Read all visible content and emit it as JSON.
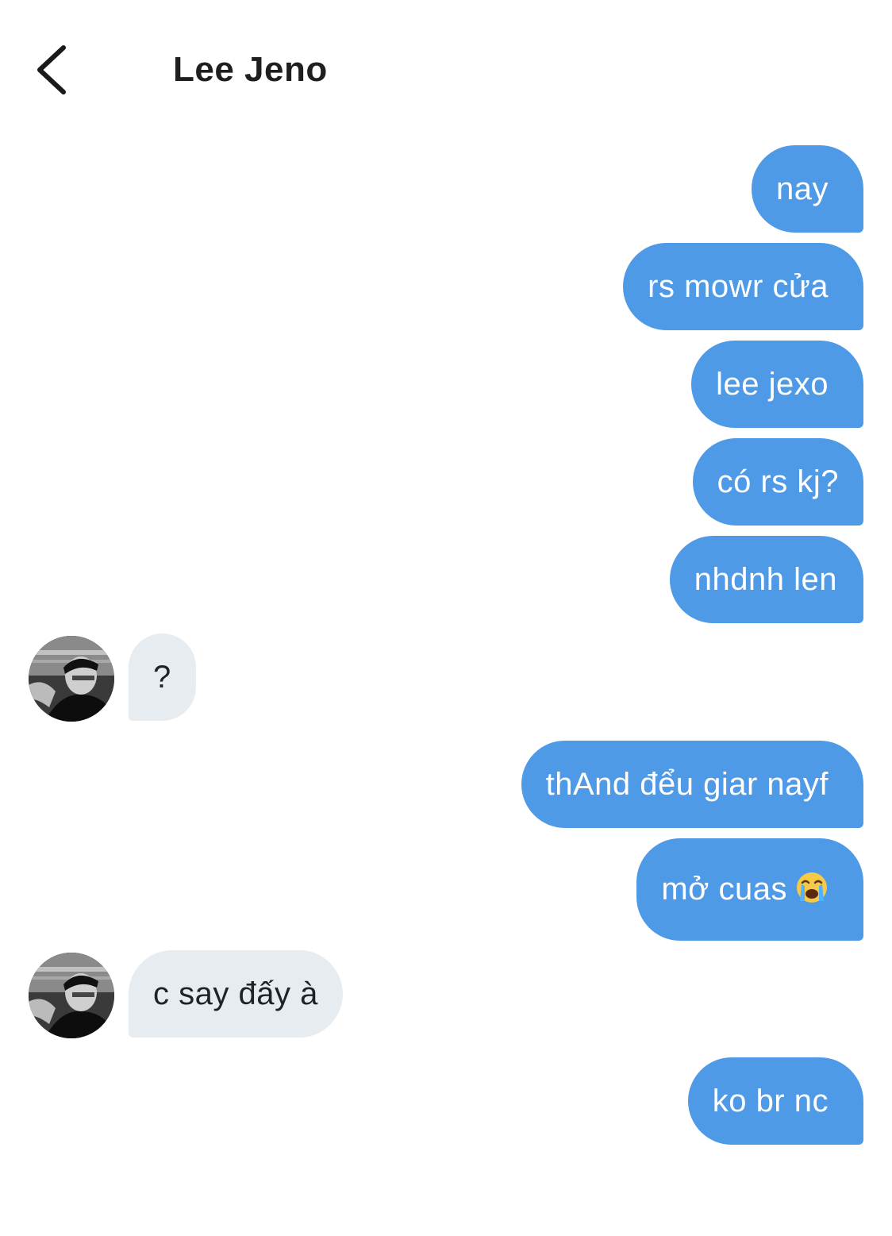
{
  "header": {
    "title": "Lee Jeno",
    "back_icon": "chevron-left-icon"
  },
  "colors": {
    "outgoing_bubble": "#4f9ae6",
    "incoming_bubble": "#e7ecf0",
    "outgoing_text": "#ffffff",
    "incoming_text": "#1f2227"
  },
  "messages": [
    {
      "direction": "outgoing",
      "text": "nay"
    },
    {
      "direction": "outgoing",
      "text": "rs mowr cửa"
    },
    {
      "direction": "outgoing",
      "text": "lee jexo"
    },
    {
      "direction": "outgoing",
      "text": "có rs kj?"
    },
    {
      "direction": "outgoing",
      "text": "nhdnh len"
    },
    {
      "direction": "incoming",
      "text": "?"
    },
    {
      "direction": "outgoing",
      "text": "thAnd đểu giar nayf"
    },
    {
      "direction": "outgoing",
      "text": "mở cuas",
      "emoji": "loudly-crying-face"
    },
    {
      "direction": "incoming",
      "text": "c say đấy à"
    },
    {
      "direction": "outgoing",
      "text": "ko br nc"
    }
  ]
}
